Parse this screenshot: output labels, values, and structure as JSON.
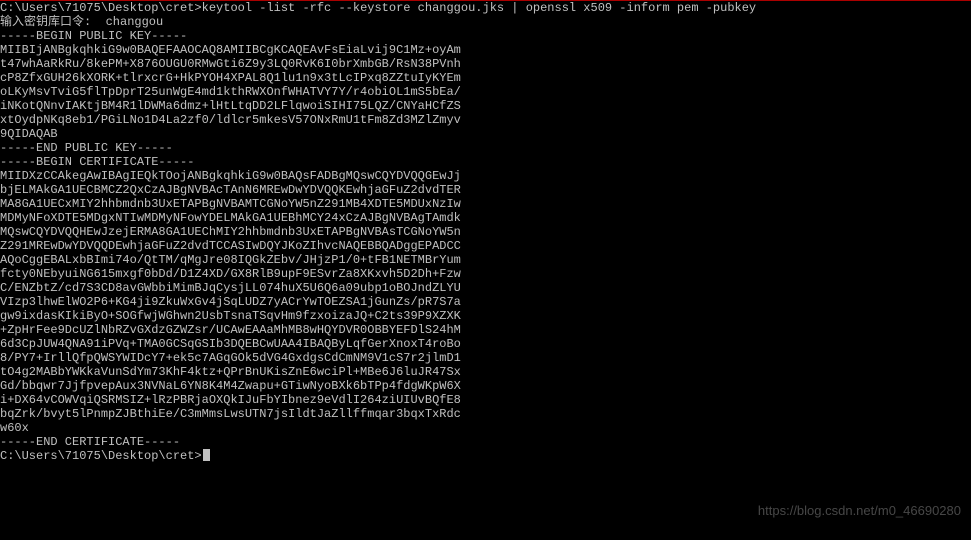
{
  "terminal": {
    "prompt_start": "C:\\Users\\71075\\Desktop\\cret>",
    "command": "keytool -list -rfc --keystore changgou.jks | openssl x509 -inform pem -pubkey",
    "password_prompt": "输入密钥库口令:  changgou",
    "pubkey_begin": "-----BEGIN PUBLIC KEY-----",
    "pubkey_lines": [
      "MIIBIjANBgkqhkiG9w0BAQEFAAOCAQ8AMIIBCgKCAQEAvFsEiaLvij9C1Mz+oyAm",
      "t47whAaRkRu/8kePM+X876OUGU0RMwGti6Z9y3LQ0RvK6I0brXmbGB/RsN38PVnh",
      "cP8ZfxGUH26kXORK+tlrxcrG+HkPYOH4XPAL8Q1lu1n9x3tLcIPxq8ZZtuIyKYEm",
      "oLKyMsvTviG5flTpDprT25unWgE4md1kthRWXOnfWHATVY7Y/r4obiOL1mS5bEa/",
      "iNKotQNnvIAKtjBM4R1lDWMa6dmz+lHtLtqDD2LFlqwoiSIHI75LQZ/CNYaHCfZS",
      "xtOydpNKq8eb1/PGiLNo1D4La2zf0/ldlcr5mkesV57ONxRmU1tFm8Zd3MZlZmyv",
      "9QIDAQAB"
    ],
    "pubkey_end": "-----END PUBLIC KEY-----",
    "cert_begin": "-----BEGIN CERTIFICATE-----",
    "cert_lines": [
      "MIIDXzCCAkegAwIBAgIEQkTOojANBgkqhkiG9w0BAQsFADBgMQswCQYDVQQGEwJj",
      "bjELMAkGA1UECBMCZ2QxCzAJBgNVBAcTAnN6MREwDwYDVQQKEwhjaGFuZ2dvdTER",
      "MA8GA1UECxMIY2hhbmdnb3UxETAPBgNVBAMTCGNoYW5nZ291MB4XDTE5MDUxNzIw",
      "MDMyNFoXDTE5MDgxNTIwMDMyNFowYDELMAkGA1UEBhMCY24xCzAJBgNVBAgTAmdk",
      "MQswCQYDVQQHEwJzejERMA8GA1UEChMIY2hhbmdnb3UxETAPBgNVBAsTCGNoYW5n",
      "Z291MREwDwYDVQQDEwhjaGFuZ2dvdTCCASIwDQYJKoZIhvcNAQEBBQADggEPADCC",
      "AQoCggEBALxbBImi74o/QtTM/qMgJre08IQGkZEbv/JHjzP1/0+tFB1NETMBrYum",
      "fcty0NEbyuiNG615mxgf0bDd/D1Z4XD/GX8RlB9upF9ESvrZa8XKxvh5D2Dh+Fzw",
      "C/ENZbtZ/cd7S3CD8avGWbbiMimBJqCysjLL074huX5U6Q6a09ubp1oBOJndZLYU",
      "VIzp3lhwElWO2P6+KG4ji9ZkuWxGv4jSqLUDZ7yACrYwTOEZSA1jGunZs/pR7S7a",
      "gw9ixdasKIkiByO+SOGfwjWGhwn2UsbTsnaTSqvHm9fzxoizaJQ+C2ts39P9XZXK",
      "+ZpHrFee9DcUZlNbRZvGXdzGZWZsr/UCAwEAAaMhMB8wHQYDVR0OBBYEFDlS24hM",
      "6d3CpJUW4QNA91iPVq+TMA0GCSqGSIb3DQEBCwUAA4IBAQByLqfGerXnoxT4roBo",
      "8/PY7+IrllQfpQWSYWIDcY7+ek5c7AGqGOk5dVG4GxdgsCdCmNM9V1cS7r2jlmD1",
      "tO4g2MABbYWKkaVunSdYm73KhF4ktz+QPrBnUKisZnE6wciPl+MBe6J6luJR47Sx",
      "Gd/bbqwr7JjfpvepAux3NVNaL6YN8K4M4Zwapu+GTiwNyoBXk6bTPp4fdgWKpW6X",
      "i+DX64vCOWVqiQSRMSIZ+lRzPBRjaOXQkIJuFbYIbnez9eVdlI264ziUIUvBQfE8",
      "bqZrk/bvyt5lPnmpZJBthiEe/C3mMmsLwsUTN7jsIldtJaZllffmqar3bqxTxRdc",
      "w60x"
    ],
    "cert_end": "-----END CERTIFICATE-----",
    "blank": "",
    "prompt_end": "C:\\Users\\71075\\Desktop\\cret>"
  },
  "watermark": "https://blog.csdn.net/m0_46690280"
}
